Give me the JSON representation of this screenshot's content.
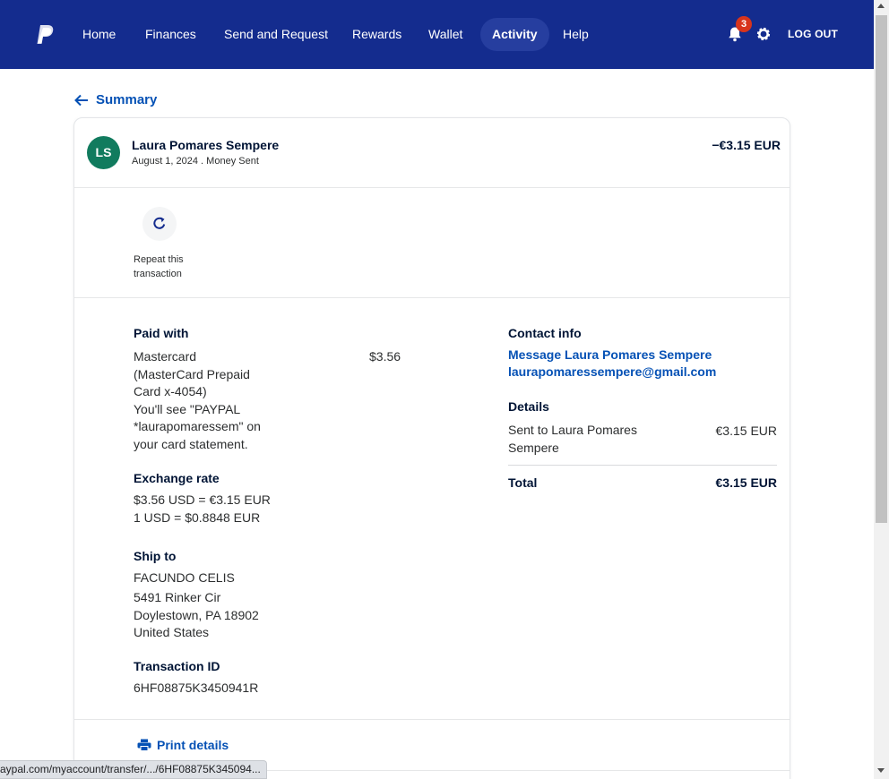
{
  "nav": {
    "items": [
      {
        "label": "Home",
        "active": false
      },
      {
        "label": "Finances",
        "active": false
      },
      {
        "label": "Send and Request",
        "active": false
      },
      {
        "label": "Rewards",
        "active": false
      },
      {
        "label": "Wallet",
        "active": false
      },
      {
        "label": "Activity",
        "active": true
      },
      {
        "label": "Help",
        "active": false
      }
    ],
    "notification_count": "3",
    "logout_label": "LOG OUT"
  },
  "back_label": "Summary",
  "transaction": {
    "avatar_initials": "LS",
    "name": "Laura Pomares Sempere",
    "subline": "August 1, 2024 . Money Sent",
    "amount": "−€3.15 EUR",
    "repeat_label": "Repeat this transaction"
  },
  "paid_with": {
    "heading": "Paid with",
    "lines": [
      "Mastercard",
      "(MasterCard Prepaid",
      "Card x-4054)",
      "You'll see \"PAYPAL",
      "*laurapomaressem\" on",
      "your card statement."
    ],
    "amount": "$3.56"
  },
  "exchange_rate": {
    "heading": "Exchange rate",
    "lines": [
      "$3.56 USD = €3.15 EUR",
      "1 USD = $0.8848 EUR"
    ]
  },
  "ship_to": {
    "heading": "Ship to",
    "lines": [
      "FACUNDO CELIS",
      "5491 Rinker Cir",
      "Doylestown, PA 18902",
      "United States"
    ]
  },
  "transaction_id": {
    "heading": "Transaction ID",
    "value": "6HF08875K3450941R"
  },
  "contact": {
    "heading": "Contact info",
    "message_link": "Message Laura Pomares Sempere",
    "email_link": "laurapomaressempere@gmail.com"
  },
  "details": {
    "heading": "Details",
    "row_label_lines": [
      "Sent to Laura Pomares",
      "Sempere"
    ],
    "row_value": "€3.15 EUR",
    "total_label": "Total",
    "total_value": "€3.15 EUR"
  },
  "print_label": "Print details",
  "status_url": "aypal.com/myaccount/transfer/.../6HF08875K345094..."
}
